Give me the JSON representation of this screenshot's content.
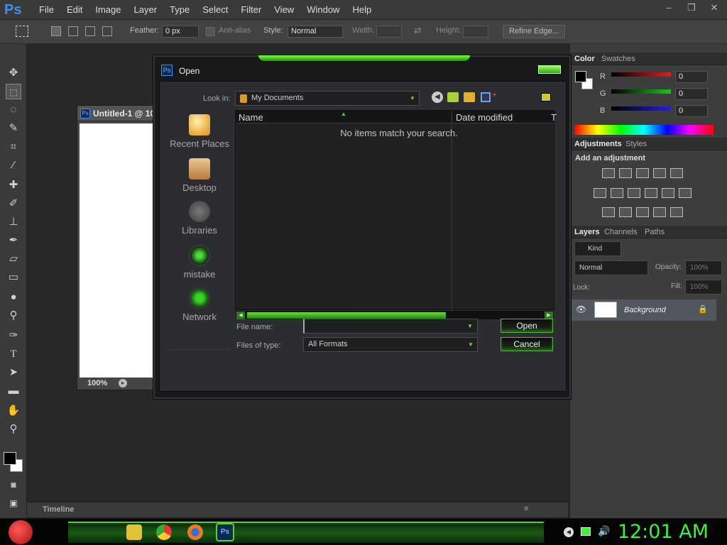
{
  "app": {
    "logo": "Ps"
  },
  "menu": [
    "File",
    "Edit",
    "Image",
    "Layer",
    "Type",
    "Select",
    "Filter",
    "View",
    "Window",
    "Help"
  ],
  "window_controls": {
    "minimize": "–",
    "restore": "❐",
    "close": "✕"
  },
  "options": {
    "feather_label": "Feather:",
    "feather_value": "0 px",
    "antialias_label": "Anti-alias",
    "style_label": "Style:",
    "style_value": "Normal",
    "width_label": "Width:",
    "height_label": "Height:",
    "refine_edge": "Refine Edge..."
  },
  "document": {
    "tab": "Untitled-1 @ 10",
    "zoom": "100%"
  },
  "timeline": {
    "label": "Timeline"
  },
  "panels": {
    "color_tabs": [
      "Color",
      "Swatches"
    ],
    "rgb": [
      {
        "label": "R",
        "value": "0",
        "color": "#e02020"
      },
      {
        "label": "G",
        "value": "0",
        "color": "#20c020"
      },
      {
        "label": "B",
        "value": "0",
        "color": "#2020e0"
      }
    ],
    "adj_tabs": [
      "Adjustments",
      "Styles"
    ],
    "adj_heading": "Add an adjustment",
    "layer_tabs": [
      "Layers",
      "Channels",
      "Paths"
    ],
    "kind": "Kind",
    "blend": "Normal",
    "opacity_label": "Opacity:",
    "opacity_value": "100%",
    "lock_label": "Lock:",
    "fill_label": "Fill:",
    "fill_value": "100%",
    "layer_name": "Background"
  },
  "dialog": {
    "title": "Open",
    "look_in_label": "Look in:",
    "look_in_value": "My Documents",
    "places": [
      "Recent Places",
      "Desktop",
      "Libraries",
      "mistake",
      "Network"
    ],
    "columns": [
      "Name",
      "Date modified",
      "T"
    ],
    "empty": "No items match your search.",
    "file_name_label": "File name:",
    "file_name_value": "",
    "file_type_label": "Files of type:",
    "file_type_value": "All Formats",
    "open": "Open",
    "cancel": "Cancel"
  },
  "taskbar": {
    "clock": "12:01 AM"
  },
  "colors": {
    "accent_green": "#3df23a",
    "ps_blue": "#3d8ff2"
  }
}
